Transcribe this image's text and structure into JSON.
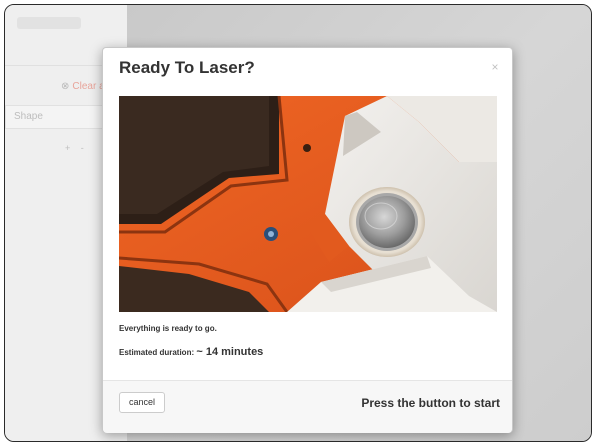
{
  "background": {
    "sidebar": {
      "clear_all_label": "Clear all",
      "clear_icon": "circle-x-icon",
      "shape_label": "Shape",
      "zoom_controls": "+ -"
    }
  },
  "modal": {
    "title": "Ready To Laser?",
    "close_label": "×",
    "status_text": "Everything is ready to go.",
    "duration_label": "Estimated duration:",
    "duration_value": "~ 14 minutes",
    "cancel_label": "cancel",
    "instruction": "Press the button to start",
    "image_subject": "laser-start-button-photo"
  },
  "colors": {
    "laser_orange": "#ea5b1f",
    "laser_body_dark": "#c94a15",
    "metal_plate": "#e8e6e2",
    "button_steel": "#bfbfbf",
    "accent_clear": "#e8a49a"
  }
}
